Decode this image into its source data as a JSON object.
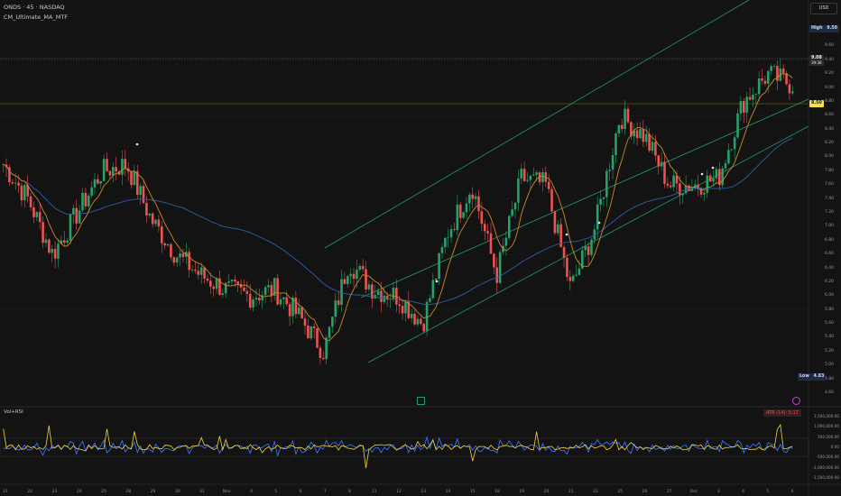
{
  "header": {
    "symbol_line": "ONDS · 45 · NASDAQ",
    "indicator_name": "CM_Ultimate_MA_MTF"
  },
  "currency": "USD",
  "price_scale": {
    "ticks": [
      "9.80",
      "9.60",
      "9.40",
      "9.20",
      "9.00",
      "8.80",
      "8.60",
      "8.40",
      "8.20",
      "8.00",
      "7.80",
      "7.60",
      "7.40",
      "7.20",
      "7.00",
      "6.80",
      "6.60",
      "6.40",
      "6.20",
      "6.00",
      "5.80",
      "5.60",
      "5.40",
      "5.20",
      "5.00",
      "4.80",
      "4.60"
    ],
    "high_label": "High",
    "high_value": "9.50",
    "current_price": "9.08",
    "current_time": "39:36",
    "line_price": "8.50",
    "low_label": "Low",
    "low_value": "4.83"
  },
  "volume_pane": {
    "title": "Vol+RSI",
    "badge": "ATR (14): 0.17",
    "ticks": [
      "1,500,000.00",
      "1,000,000.00",
      "500,000.00",
      "0.00",
      "-500,000.00",
      "-1,000,000.00",
      "-1,500,000.00"
    ]
  },
  "time_axis": {
    "labels": [
      "21",
      "22",
      "23",
      "24",
      "25",
      "28",
      "29",
      "30",
      "31",
      "Nov",
      "4",
      "5",
      "6",
      "7",
      "8",
      "11",
      "12",
      "13",
      "14",
      "15",
      "18",
      "19",
      "20",
      "21",
      "22",
      "25",
      "26",
      "27",
      "Dec",
      "3",
      "4",
      "5",
      "6"
    ]
  },
  "colors": {
    "background": "#131313",
    "up_candle": "#26a269",
    "down_candle": "#ef5350",
    "ma_fast": "#c9882b",
    "ma_slow": "#2e5fa8",
    "channel": "#1f9e6e",
    "vol_blue": "#3b6ff5",
    "vol_yellow": "#f5d33b",
    "price_line": "#8f7a1f"
  },
  "chart_data": {
    "type": "candlestick",
    "x_labels": [
      "21",
      "22",
      "23",
      "24",
      "25",
      "28",
      "29",
      "30",
      "31",
      "Nov",
      "4",
      "5",
      "6",
      "7",
      "8",
      "11",
      "12",
      "13",
      "14",
      "15",
      "18",
      "19",
      "20",
      "21",
      "22",
      "25",
      "26",
      "27",
      "Dec",
      "3",
      "4",
      "5",
      "6"
    ],
    "ylim": [
      4.6,
      9.8
    ],
    "approx_closes": [
      7.9,
      7.4,
      6.6,
      7.2,
      7.8,
      7.9,
      7.1,
      6.6,
      6.3,
      6.1,
      6.0,
      6.1,
      5.7,
      5.2,
      6.5,
      6.1,
      6.0,
      5.6,
      6.9,
      7.6,
      6.3,
      7.7,
      7.6,
      6.1,
      7.0,
      8.6,
      8.3,
      7.6,
      7.6,
      7.7,
      8.8,
      9.2,
      9.05
    ],
    "high": 9.5,
    "low": 4.83,
    "last": 9.08
  }
}
